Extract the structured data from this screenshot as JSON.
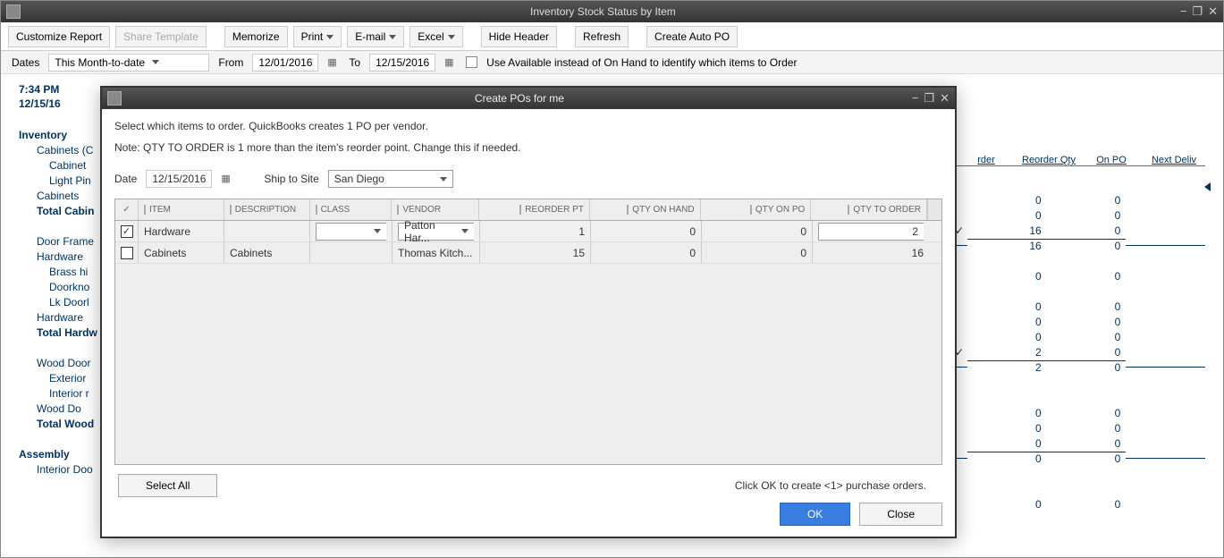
{
  "window": {
    "title": "Inventory Stock Status by Item",
    "minimize": "−",
    "restore": "❐",
    "close": "✕"
  },
  "toolbar": {
    "customize": "Customize Report",
    "share": "Share Template",
    "memorize": "Memorize",
    "print": "Print",
    "email": "E-mail",
    "excel": "Excel",
    "hide_header": "Hide Header",
    "refresh": "Refresh",
    "create_po": "Create Auto PO"
  },
  "filters": {
    "dates_label": "Dates",
    "dates_value": "This Month-to-date",
    "from_label": "From",
    "from_value": "12/01/2016",
    "to_label": "To",
    "to_value": "12/15/2016",
    "use_available": "Use Available instead of On Hand to identify which items to Order"
  },
  "report": {
    "time": "7:34 PM",
    "date": "12/15/16",
    "tree": [
      {
        "class": "l0",
        "label": "Inventory"
      },
      {
        "class": "l1",
        "label": "Cabinets (C"
      },
      {
        "class": "l2",
        "label": "Cabinet"
      },
      {
        "class": "l2",
        "label": "Light Pin"
      },
      {
        "class": "l1",
        "label": "Cabinets"
      },
      {
        "class": "lt",
        "label": "Total Cabin"
      },
      {
        "class": "spacer-row",
        "label": ""
      },
      {
        "class": "l1",
        "label": "Door Frame"
      },
      {
        "class": "l1",
        "label": "Hardware"
      },
      {
        "class": "l2",
        "label": "Brass hi"
      },
      {
        "class": "l2",
        "label": "Doorkno"
      },
      {
        "class": "l2",
        "label": "Lk Doorl"
      },
      {
        "class": "l1",
        "label": "Hardware"
      },
      {
        "class": "lt",
        "label": "Total Hardw"
      },
      {
        "class": "spacer-row",
        "label": ""
      },
      {
        "class": "l1",
        "label": "Wood Door"
      },
      {
        "class": "l2",
        "label": "Exterior"
      },
      {
        "class": "l2",
        "label": "Interior r"
      },
      {
        "class": "l1",
        "label": "Wood Do"
      },
      {
        "class": "lt",
        "label": "Total Wood"
      },
      {
        "class": "spacer-row",
        "label": ""
      },
      {
        "class": "l0",
        "label": "Assembly"
      },
      {
        "class": "l1",
        "label": "Interior Doo"
      }
    ],
    "right_headers": [
      "rder",
      "Reorder Qty",
      "On PO",
      "Next Deliv"
    ],
    "right_rows": [
      {
        "chk": "",
        "a": "",
        "b": "",
        "c": ""
      },
      {
        "chk": "",
        "a": "0",
        "b": "0",
        "c": ""
      },
      {
        "chk": "",
        "a": "0",
        "b": "0",
        "c": ""
      },
      {
        "chk": "✓",
        "a": "16",
        "b": "0",
        "c": "",
        "sum": false
      },
      {
        "chk": "",
        "a": "16",
        "b": "0",
        "c": "",
        "sum": true
      },
      {
        "chk": "",
        "a": "",
        "b": "",
        "c": ""
      },
      {
        "chk": "",
        "a": "0",
        "b": "0",
        "c": ""
      },
      {
        "chk": "",
        "a": "",
        "b": "",
        "c": ""
      },
      {
        "chk": "",
        "a": "0",
        "b": "0",
        "c": ""
      },
      {
        "chk": "",
        "a": "0",
        "b": "0",
        "c": ""
      },
      {
        "chk": "",
        "a": "0",
        "b": "0",
        "c": ""
      },
      {
        "chk": "✓",
        "a": "2",
        "b": "0",
        "c": "",
        "sum": false
      },
      {
        "chk": "",
        "a": "2",
        "b": "0",
        "c": "",
        "sum": true
      },
      {
        "chk": "",
        "a": "",
        "b": "",
        "c": ""
      },
      {
        "chk": "",
        "a": "",
        "b": "",
        "c": ""
      },
      {
        "chk": "",
        "a": "0",
        "b": "0",
        "c": ""
      },
      {
        "chk": "",
        "a": "0",
        "b": "0",
        "c": ""
      },
      {
        "chk": "",
        "a": "0",
        "b": "0",
        "c": "",
        "sum": false
      },
      {
        "chk": "",
        "a": "0",
        "b": "0",
        "c": "",
        "sum": true
      },
      {
        "chk": "",
        "a": "",
        "b": "",
        "c": ""
      },
      {
        "chk": "",
        "a": "",
        "b": "",
        "c": ""
      },
      {
        "chk": "",
        "a": "0",
        "b": "0",
        "c": ""
      }
    ]
  },
  "dialog": {
    "title": "Create POs for me",
    "info1": "Select which items to order. QuickBooks creates 1 PO per vendor.",
    "info2": "Note: QTY TO ORDER is 1 more than the item's reorder point. Change this if needed.",
    "date_label": "Date",
    "date_value": "12/15/2016",
    "ship_label": "Ship to Site",
    "ship_value": "San Diego",
    "headers": {
      "chk": "✓",
      "item": "ITEM",
      "desc": "DESCRIPTION",
      "class": "CLASS",
      "vendor": "VENDOR",
      "reorder": "REORDER PT",
      "onhand": "QTY ON HAND",
      "onpo": "QTY ON PO",
      "toorder": "QTY TO ORDER"
    },
    "rows": [
      {
        "chk": "✓",
        "item": "Hardware",
        "desc": "",
        "class": "",
        "vendor": "Patton Har...",
        "reorder": "1",
        "onhand": "0",
        "onpo": "0",
        "toorder": "2",
        "active": true
      },
      {
        "chk": "",
        "item": "Cabinets",
        "desc": "Cabinets",
        "class": "",
        "vendor": "Thomas Kitch...",
        "reorder": "15",
        "onhand": "0",
        "onpo": "0",
        "toorder": "16",
        "active": false
      }
    ],
    "select_all": "Select All",
    "hint": "Click OK to create <1> purchase orders.",
    "ok": "OK",
    "close": "Close"
  }
}
